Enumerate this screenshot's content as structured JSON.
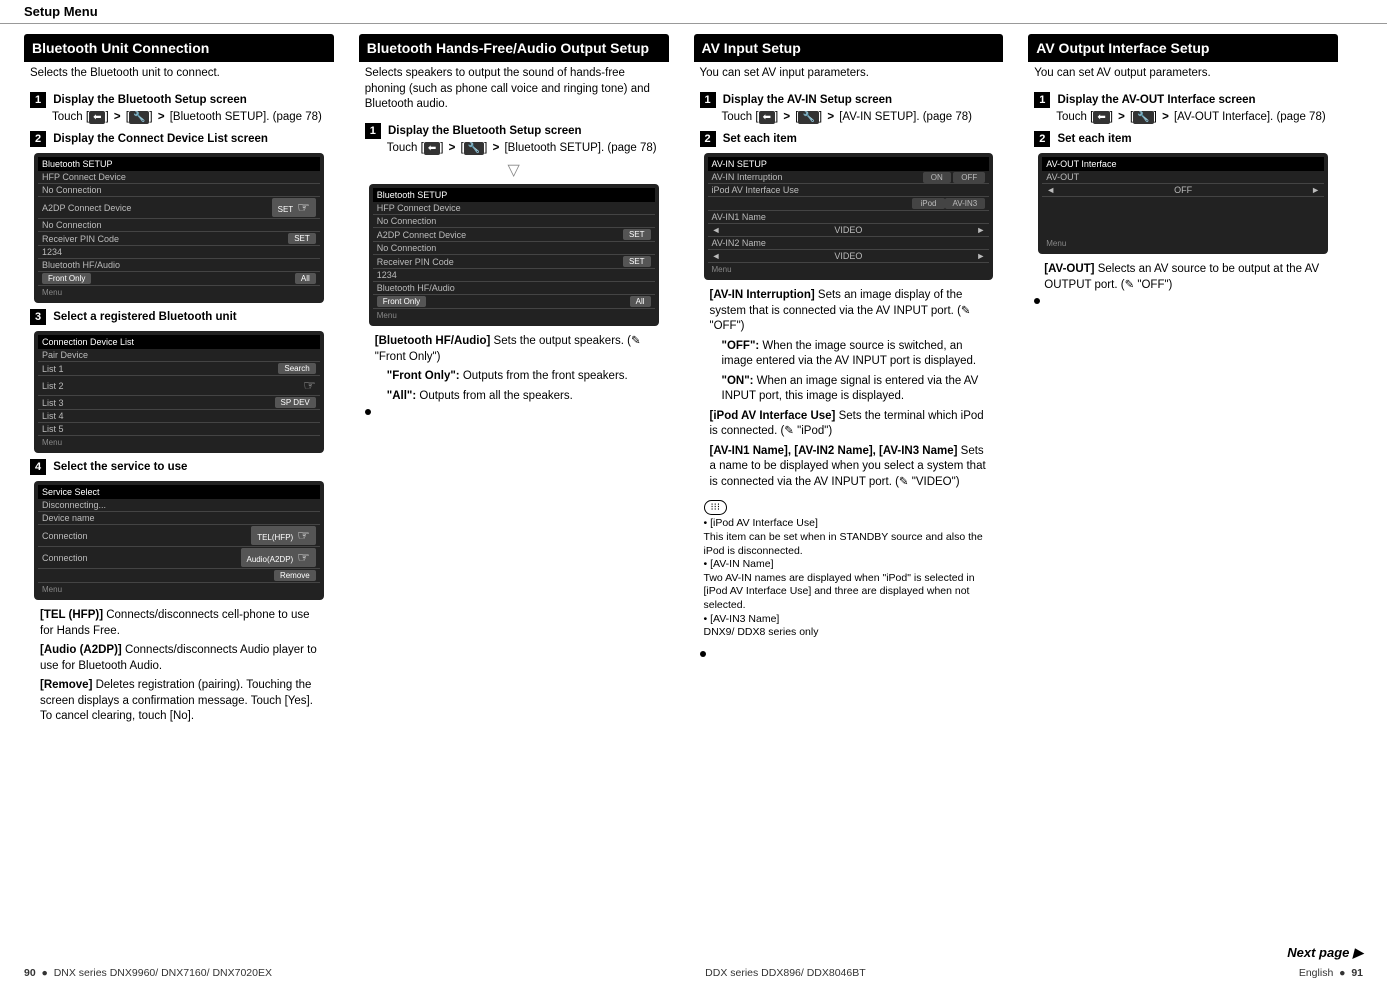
{
  "header": "Setup Menu",
  "col1": {
    "title": "Bluetooth Unit Connection",
    "intro": "Selects the Bluetooth unit to connect.",
    "step1title": "Display the Bluetooth Setup screen",
    "step1body1": "Touch [",
    "step1body2": "] ",
    "step1body3": " [",
    "step1body4": "] ",
    "step1body5": " [Bluetooth SETUP]. (page 78)",
    "step2title": "Display the Connect Device List screen",
    "scr1_title": "Bluetooth SETUP",
    "scr1_r1": "HFP Connect Device",
    "scr1_r1v": "No Connection",
    "scr1_r2": "A2DP Connect Device",
    "scr1_r2v": "No Connection",
    "scr1_r3": "Receiver PIN Code",
    "scr1_r3v": "1234",
    "scr1_r4": "Bluetooth HF/Audio",
    "scr1_r4v": "Front Only",
    "scr1_set": "SET",
    "scr1_all": "All",
    "scr1_menu": "Menu",
    "step3title": "Select a registered Bluetooth unit",
    "scr2_title": "Connection Device List",
    "scr2_sub": "Pair Device",
    "scr2_l1": "List 1",
    "scr2_l2": "List 2",
    "scr2_l3": "List 3",
    "scr2_l4": "List 4",
    "scr2_l5": "List 5",
    "scr2_search": "Search",
    "scr2_spdev": "SP DEV",
    "step4title": "Select the service to use",
    "scr3_title": "Service Select",
    "scr3_disc": "Disconnecting...",
    "scr3_devname": "Device name",
    "scr3_conn": "Connection",
    "scr3_tel": "TEL(HFP)",
    "scr3_a2dp": "Audio(A2DP)",
    "scr3_remove": "Remove",
    "def_tel_label": "[TEL (HFP)]",
    "def_tel": "   Connects/disconnects cell-phone to use for Hands Free.",
    "def_a2dp_label": "[Audio (A2DP)]",
    "def_a2dp": "   Connects/disconnects Audio player to use for Bluetooth Audio.",
    "def_rem_label": "[Remove]",
    "def_rem": "   Deletes registration (pairing). Touching the screen displays a confirmation message. Touch [Yes]. To cancel clearing, touch [No]."
  },
  "col2": {
    "title": "Bluetooth Hands-Free/Audio Output Setup",
    "intro": "Selects speakers to output the sound of hands-free phoning (such as phone call voice and ringing tone) and Bluetooth audio.",
    "step1title": "Display the Bluetooth Setup screen",
    "step1body": " [Bluetooth SETUP]. (page 78)",
    "def_hf_label": "[Bluetooth HF/Audio]",
    "def_hf": "   Sets the output speakers. (",
    "def_hf2": " \"Front Only\")",
    "front_label": "\"Front Only\":",
    "front": "  Outputs from the front speakers.",
    "all_label": "\"All\":",
    "all": "  Outputs from all the speakers."
  },
  "col3": {
    "title": "AV Input Setup",
    "intro": "You can set AV input parameters.",
    "step1title": "Display the AV-IN Setup screen",
    "step1body": " [AV-IN SETUP]. (page 78)",
    "step2title": "Set each item",
    "scr_title": "AV-IN SETUP",
    "scr_r1": "AV-IN Interruption",
    "scr_r1a": "ON",
    "scr_r1b": "OFF",
    "scr_r2": "iPod AV Interface Use",
    "scr_r2a": "iPod",
    "scr_r2b": "AV-IN3",
    "scr_r3": "AV-IN1 Name",
    "scr_r3v": "VIDEO",
    "scr_r4": "AV-IN2 Name",
    "scr_r4v": "VIDEO",
    "def_int_label": "[AV-IN Interruption]",
    "def_int": "   Sets an image display of the system that is connected via the AV INPUT port. (",
    "def_int2": " \"OFF\")",
    "off_label": "\"OFF\":",
    "off": " When the image source is switched, an image entered via the AV INPUT port is displayed.",
    "on_label": "\"ON\":",
    "on": " When an image signal is entered via the AV INPUT port, this image is displayed.",
    "def_ipod_label": "[iPod AV Interface Use]",
    "def_ipod": "   Sets the terminal which iPod is connected. (",
    "def_ipod2": " \"iPod\")",
    "def_name_label": "[AV-IN1 Name], [AV-IN2 Name], [AV-IN3 Name]",
    "def_name": "   Sets a name to be displayed when you select a system that is connected via the AV INPUT port. (",
    "def_name2": " \"VIDEO\")",
    "note1_label": "[iPod AV Interface Use]",
    "note1": "This item can be set when in STANDBY source and also the iPod is disconnected.",
    "note2_label": "[AV-IN Name]",
    "note2": "Two AV-IN names are displayed when \"iPod\" is selected in [iPod AV Interface Use] and three are displayed when not selected.",
    "note3_label": "[AV-IN3 Name]",
    "note3": "DNX9/ DDX8 series only"
  },
  "col4": {
    "title": "AV Output Interface Setup",
    "intro": "You can set AV output parameters.",
    "step1title": "Display the AV-OUT Interface screen",
    "step1body": " [AV-OUT Interface]. (page 78)",
    "step2title": "Set each item",
    "scr_title": "AV-OUT Interface",
    "scr_r1": "AV-OUT",
    "scr_r1v": "OFF",
    "def_label": "[AV-OUT]",
    "def": "   Selects an AV source to be output at the AV OUTPUT port. (",
    "def2": " \"OFF\")"
  },
  "nextpage": "Next page ▶",
  "foot_left_pg": "90",
  "foot_left": "DNX series   DNX9960/ DNX7160/ DNX7020EX",
  "foot_mid": "DDX series   DDX896/ DDX8046BT",
  "foot_right": "English",
  "foot_right_pg": "91",
  "icons": {
    "back": "⬅",
    "tool": "🔧",
    "preset": "✎"
  }
}
